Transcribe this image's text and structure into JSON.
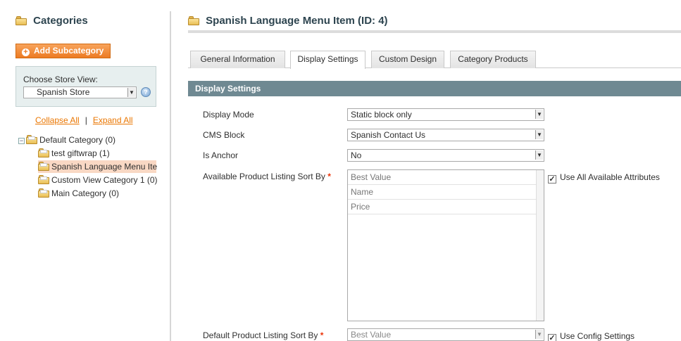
{
  "sidebar": {
    "title": "Categories",
    "add_button": "Add Subcategory",
    "store_label": "Choose Store View:",
    "store_value": "Spanish Store",
    "collapse_all": "Collapse All",
    "separator": "|",
    "expand_all": "Expand All",
    "tree": [
      {
        "label": "Default Category (0)"
      },
      {
        "label": "test giftwrap (1)"
      },
      {
        "label": "Spanish Language Menu Ite"
      },
      {
        "label": "Custom View Category 1 (0)"
      },
      {
        "label": "Main Category (0)"
      }
    ]
  },
  "main": {
    "title": "Spanish Language Menu Item (ID: 4)",
    "tabs": [
      {
        "label": "General Information"
      },
      {
        "label": "Display Settings"
      },
      {
        "label": "Custom Design"
      },
      {
        "label": "Category Products"
      }
    ],
    "active_tab": "Display Settings",
    "section_title": "Display Settings",
    "fields": {
      "display_mode": {
        "label": "Display Mode",
        "value": "Static block only"
      },
      "cms_block": {
        "label": "CMS Block",
        "value": "Spanish Contact Us"
      },
      "is_anchor": {
        "label": "Is Anchor",
        "value": "No"
      },
      "sort_by": {
        "label": "Available Product Listing Sort By",
        "options": [
          "Best Value",
          "Name",
          "Price"
        ],
        "checkbox_label": "Use All Available Attributes",
        "checked": true
      },
      "default_sort": {
        "label": "Default Product Listing Sort By",
        "value": "Best Value",
        "checkbox_label": "Use Config Settings",
        "checked": true
      }
    },
    "required_mark": "*"
  },
  "colors": {
    "accent_orange": "#ec7b22",
    "section_header": "#6f8992",
    "link": "#ea7601",
    "selected_node": "#f9d8c4"
  }
}
